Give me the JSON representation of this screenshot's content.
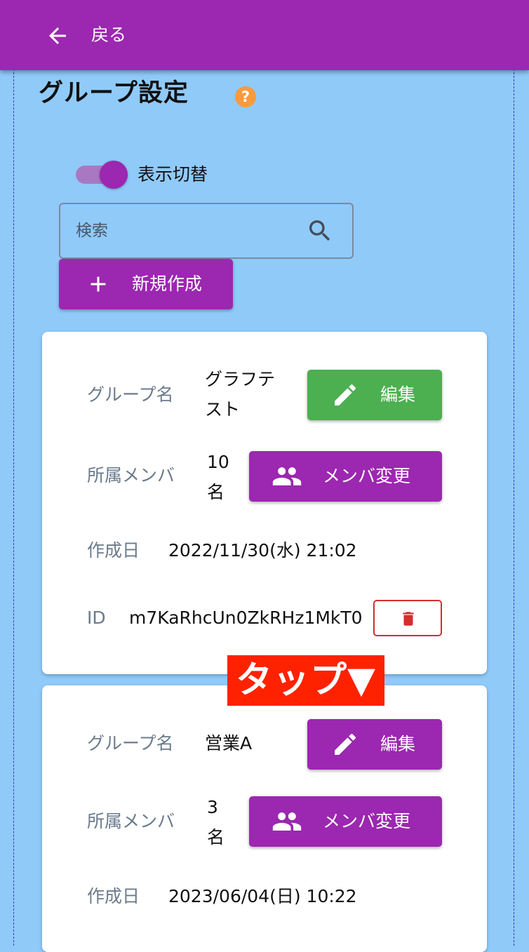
{
  "appbar": {
    "back_label": "戻る"
  },
  "page": {
    "title": "グループ設定",
    "help_glyph": "?"
  },
  "controls": {
    "toggle_label": "表示切替",
    "toggle_on": true,
    "search_placeholder": "検索",
    "new_label": "新規作成"
  },
  "groups": [
    {
      "name_label": "グループ名",
      "name_line1": "グラフテ",
      "name_line2": "スト",
      "edit_label": "編集",
      "edit_color": "#4caf50",
      "members_label": "所属メンバ",
      "members_count": "10",
      "members_unit": "名",
      "change_members_label": "メンバ変更",
      "created_label": "作成日",
      "created_value": "2022/11/30(水) 21:02",
      "id_label": "ID",
      "id_value": "m7KaRhcUn0ZkRHz1MkT0"
    },
    {
      "name_label": "グループ名",
      "name_line1": "営業A",
      "edit_label": "編集",
      "edit_color": "#9c27b0",
      "members_label": "所属メンバ",
      "members_count": "3",
      "members_unit": "名",
      "change_members_label": "メンバ変更",
      "created_label": "作成日",
      "created_value": "2023/06/04(日) 10:22"
    }
  ],
  "annotation": {
    "text": "タップ▼"
  },
  "colors": {
    "primary": "#9c27b0",
    "background": "#90caf9",
    "success": "#4caf50",
    "danger": "#d32f2f",
    "annotation": "#ff2200"
  }
}
